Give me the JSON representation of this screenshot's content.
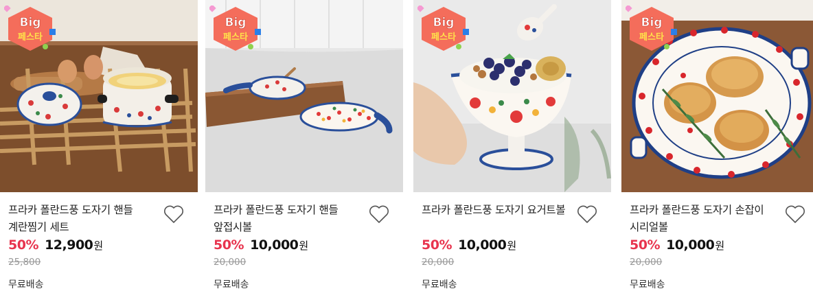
{
  "colors": {
    "discount": "#e8344e",
    "badge_fill": "#f46d5b",
    "badge_text_top": "#ffffff"
  },
  "badge": {
    "line1": "Big",
    "line2": "페스타"
  },
  "products": [
    {
      "title": "프라카 폴란드풍 도자기 핸들 계란찜기 세트",
      "discount": "50%",
      "price": "12,900",
      "currency": "원",
      "original_price": "25,800",
      "shipping": "무료배송",
      "wishlist_icon": "heart-outline-icon"
    },
    {
      "title": "프라카 폴란드풍 도자기 핸들 앞접시볼",
      "discount": "50%",
      "price": "10,000",
      "currency": "원",
      "original_price": "20,000",
      "shipping": "무료배송",
      "wishlist_icon": "heart-outline-icon"
    },
    {
      "title": "프라카 폴란드풍 도자기 요거트볼",
      "discount": "50%",
      "price": "10,000",
      "currency": "원",
      "original_price": "20,000",
      "shipping": "무료배송",
      "wishlist_icon": "heart-outline-icon"
    },
    {
      "title": "프라카 폴란드풍 도자기 손잡이 시리얼볼",
      "discount": "50%",
      "price": "10,000",
      "currency": "원",
      "original_price": "20,000",
      "shipping": "무료배송",
      "wishlist_icon": "heart-outline-icon"
    }
  ]
}
